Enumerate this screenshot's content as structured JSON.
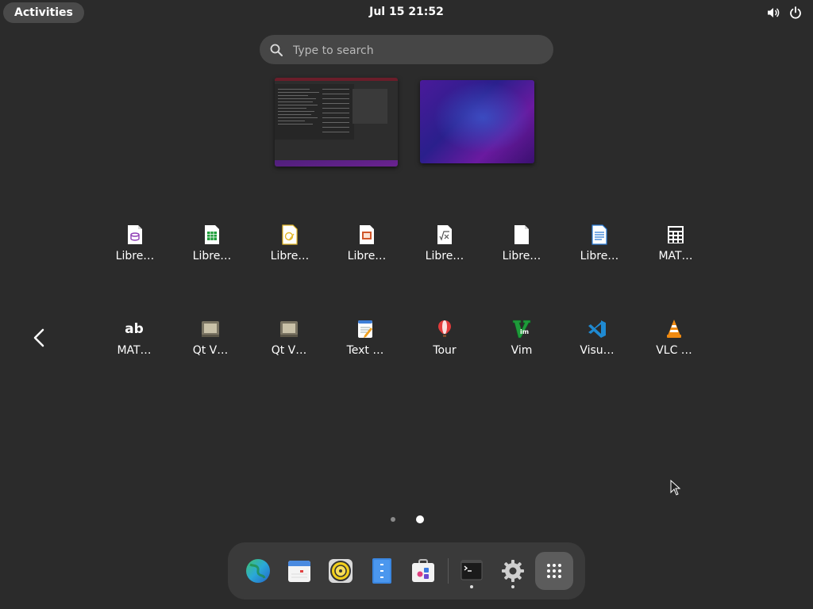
{
  "topbar": {
    "activities_label": "Activities",
    "clock": "Jul 15  21:52",
    "volume_icon": "volume-icon",
    "power_icon": "power-icon"
  },
  "search": {
    "placeholder": "Type to search"
  },
  "workspaces": [
    "workspace-1-thumbnail",
    "workspace-2-thumbnail"
  ],
  "app_grid": {
    "row1": [
      {
        "label": "Libre…",
        "icon": "libreoffice-base-icon"
      },
      {
        "label": "Libre…",
        "icon": "libreoffice-calc-icon"
      },
      {
        "label": "Libre…",
        "icon": "libreoffice-draw-icon"
      },
      {
        "label": "Libre…",
        "icon": "libreoffice-impress-icon"
      },
      {
        "label": "Libre…",
        "icon": "libreoffice-math-icon"
      },
      {
        "label": "Libre…",
        "icon": "libreoffice-icon"
      },
      {
        "label": "Libre…",
        "icon": "libreoffice-writer-icon"
      },
      {
        "label": "MAT…",
        "icon": "mate-calculator-icon"
      }
    ],
    "row2": [
      {
        "label": "MAT…",
        "icon": "mate-charmap-icon",
        "glyph": "ab"
      },
      {
        "label": "Qt V…",
        "icon": "qt-v-icon"
      },
      {
        "label": "Qt V…",
        "icon": "qt-v-icon"
      },
      {
        "label": "Text …",
        "icon": "text-editor-icon"
      },
      {
        "label": "Tour",
        "icon": "tour-balloon-icon"
      },
      {
        "label": "Vim",
        "icon": "vim-icon"
      },
      {
        "label": "Visu…",
        "icon": "vscode-icon"
      },
      {
        "label": "VLC …",
        "icon": "vlc-icon"
      }
    ]
  },
  "pagination": {
    "pages": 2,
    "current": 2
  },
  "dash": {
    "items": [
      {
        "name": "web-browser-icon"
      },
      {
        "name": "calendar-icon"
      },
      {
        "name": "rhythmbox-icon"
      },
      {
        "name": "file-manager-icon"
      },
      {
        "name": "software-store-icon"
      },
      {
        "name": "terminal-icon"
      },
      {
        "name": "settings-gear-icon"
      },
      {
        "name": "show-apps-icon"
      }
    ]
  },
  "colors": {
    "background": "#2b2b2b",
    "pill": "#4a4a4a",
    "search_bg": "#464646",
    "dash_bg": "#3a3a3a"
  }
}
